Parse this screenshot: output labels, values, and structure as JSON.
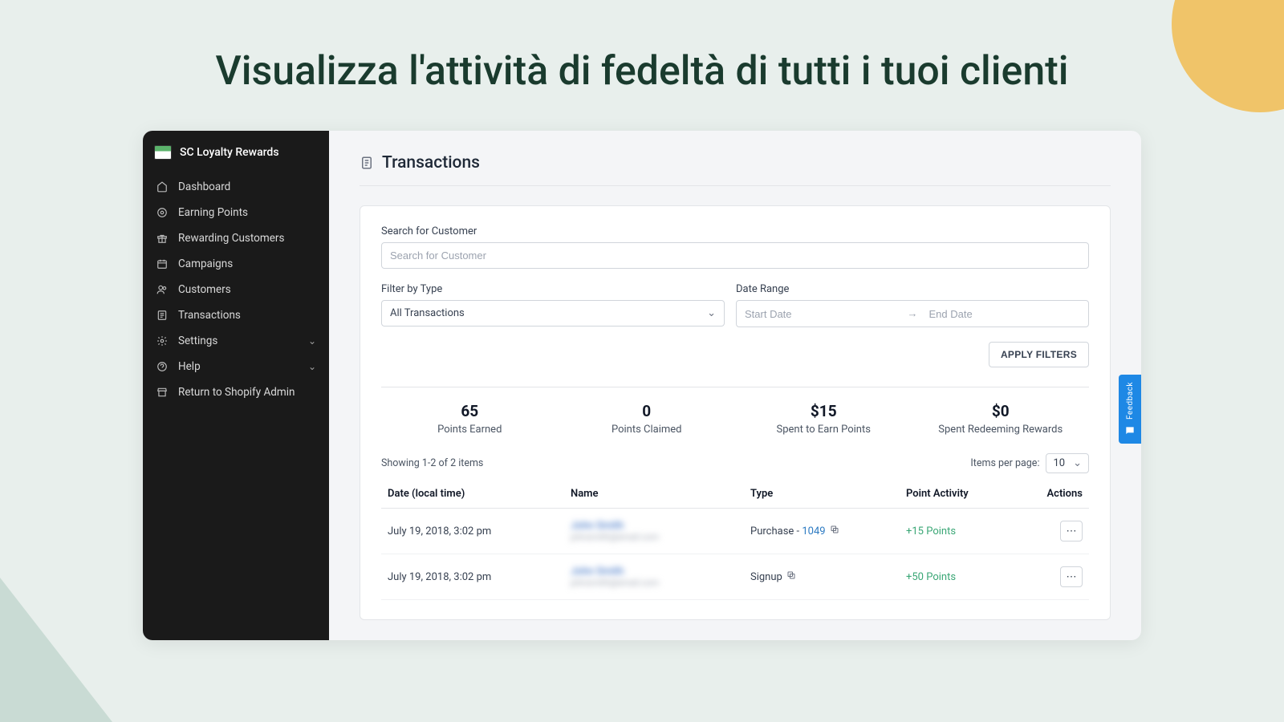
{
  "marketing_headline": "Visualizza l'attività di fedeltà di tutti i tuoi clienti",
  "sidebar": {
    "app_name": "SC Loyalty Rewards",
    "items": [
      {
        "icon": "home",
        "label": "Dashboard"
      },
      {
        "icon": "target",
        "label": "Earning Points"
      },
      {
        "icon": "gift",
        "label": "Rewarding Customers"
      },
      {
        "icon": "calendar",
        "label": "Campaigns"
      },
      {
        "icon": "users",
        "label": "Customers"
      },
      {
        "icon": "list",
        "label": "Transactions"
      },
      {
        "icon": "gear",
        "label": "Settings",
        "expandable": true
      },
      {
        "icon": "help",
        "label": "Help",
        "expandable": true
      },
      {
        "icon": "store",
        "label": "Return to Shopify Admin"
      }
    ]
  },
  "page": {
    "title": "Transactions",
    "search_label": "Search for Customer",
    "search_placeholder": "Search for Customer",
    "filter_type_label": "Filter by Type",
    "filter_type_value": "All Transactions",
    "date_range_label": "Date Range",
    "start_date_placeholder": "Start Date",
    "end_date_placeholder": "End Date",
    "apply_filters_label": "APPLY FILTERS",
    "stats": [
      {
        "value": "65",
        "label": "Points Earned"
      },
      {
        "value": "0",
        "label": "Points Claimed"
      },
      {
        "value": "$15",
        "label": "Spent to Earn Points"
      },
      {
        "value": "$0",
        "label": "Spent Redeeming Rewards"
      }
    ],
    "showing_text": "Showing 1-2 of 2 items",
    "items_per_page_label": "Items per page:",
    "items_per_page_value": "10",
    "columns": {
      "date": "Date (local time)",
      "name": "Name",
      "type": "Type",
      "point_activity": "Point Activity",
      "actions": "Actions"
    },
    "rows": [
      {
        "date": "July 19, 2018, 3:02 pm",
        "name": "John Smith",
        "email": "johnsmith@email.com",
        "type_prefix": "Purchase - ",
        "type_link": "1049",
        "point_activity": "+15 Points"
      },
      {
        "date": "July 19, 2018, 3:02 pm",
        "name": "John Smith",
        "email": "johnsmith@email.com",
        "type_prefix": "Signup ",
        "type_link": "",
        "point_activity": "+50 Points"
      }
    ]
  },
  "feedback_tab": "Feedback"
}
